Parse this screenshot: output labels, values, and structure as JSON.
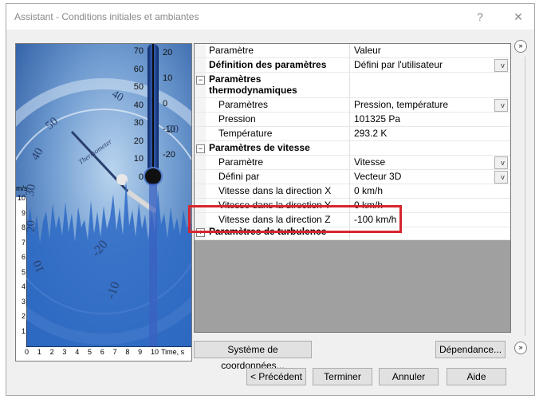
{
  "window": {
    "title": "Assistant - Conditions initiales et ambiantes",
    "help_label": "?",
    "close_label": "✕"
  },
  "grid": {
    "header": {
      "param": "Paramètre",
      "value": "Valeur"
    },
    "rows": [
      {
        "param": "Définition des paramètres",
        "value": "Défini par l'utilisateur"
      },
      {
        "param": "Paramètres thermodynamiques",
        "value": ""
      },
      {
        "param": "Paramètres",
        "value": "Pression, température"
      },
      {
        "param": "Pression",
        "value": "101325 Pa"
      },
      {
        "param": "Température",
        "value": "293.2 K"
      },
      {
        "param": "Paramètres de vitesse",
        "value": ""
      },
      {
        "param": "Paramètre",
        "value": "Vitesse"
      },
      {
        "param": "Défini par",
        "value": "Vecteur 3D"
      },
      {
        "param": "Vitesse dans la direction X",
        "value": "0 km/h"
      },
      {
        "param": "Vitesse dans la direction Y",
        "value": "0 km/h"
      },
      {
        "param": "Vitesse dans la direction Z",
        "value": "-100 km/h"
      },
      {
        "param": "Paramètres de turbulence",
        "value": ""
      }
    ]
  },
  "illustration": {
    "y_unit": "m/s",
    "x_unit": "Time, s",
    "thermo_left": [
      "70",
      "60",
      "50",
      "40",
      "30",
      "20",
      "10",
      "0"
    ],
    "thermo_right": [
      "20",
      "10",
      "0",
      "-10",
      "-20"
    ],
    "y_ticks": [
      "10",
      "9",
      "8",
      "7",
      "6",
      "5",
      "4",
      "3",
      "2",
      "1"
    ],
    "x_ticks": [
      "0",
      "1",
      "2",
      "3",
      "4",
      "5",
      "6",
      "7",
      "8",
      "9",
      "10"
    ],
    "dial_numbers": [
      "50",
      "40",
      "30",
      "20",
      "10",
      "-10",
      "-20",
      "40",
      "20"
    ],
    "dial_text": "Thermometer"
  },
  "buttons": {
    "coords": "Système de coordonnées...",
    "dependency": "Dépendance...",
    "prev": "< Précédent",
    "finish": "Terminer",
    "cancel": "Annuler",
    "help": "Aide"
  },
  "icons": {
    "expand_collapsed": "+",
    "expand_open": "−",
    "dropdown": "v",
    "side_nav": "»"
  }
}
